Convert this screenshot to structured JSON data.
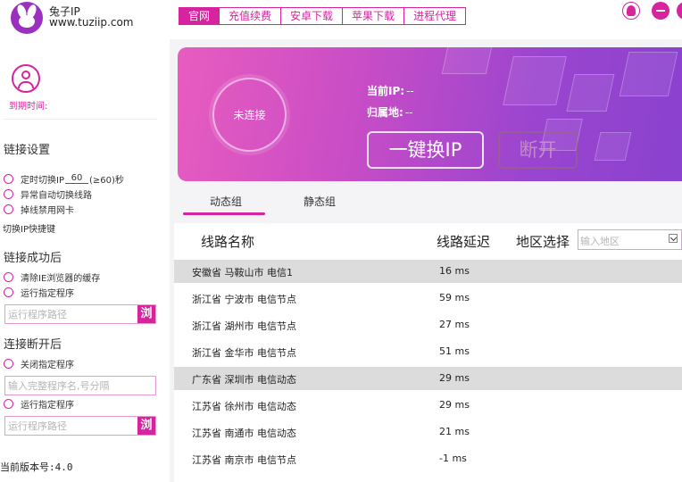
{
  "app": {
    "name": "兔子IP",
    "url": "www.tuziip.com"
  },
  "nav": [
    {
      "label": "官网",
      "active": true
    },
    {
      "label": "充值续费",
      "active": false
    },
    {
      "label": "安卓下载",
      "active": false
    },
    {
      "label": "苹果下载",
      "active": false
    },
    {
      "label": "进程代理",
      "active": false
    }
  ],
  "sidebar": {
    "expiry_label": "到期时间:",
    "link_settings": {
      "title": "链接设置",
      "timer_label": "定时切换IP",
      "timer_value": "60",
      "timer_suffix": "(≥60)秒",
      "auto_switch": "异常自动切换线路",
      "disable_nic": "掉线禁用网卡",
      "hotkey": "切换IP快捷键"
    },
    "on_success": {
      "title": "链接成功后",
      "clear_cache": "清除IE浏览器的缓存",
      "run_program": "运行指定程序",
      "path_placeholder": "运行程序路径",
      "browse": "浏览"
    },
    "on_disconnect": {
      "title": "连接断开后",
      "close_program": "关闭指定程序",
      "close_placeholder": "输入完整程序名,号分隔",
      "run_program": "运行指定程序",
      "path_placeholder": "运行程序路径",
      "browse": "浏览"
    },
    "version": "当前版本号:4.0"
  },
  "status": {
    "connection": "未连接",
    "current_ip_label": "当前IP:",
    "current_ip_value": "--",
    "location_label": "归属地:",
    "location_value": "--",
    "switch_button": "一键换IP",
    "disconnect_button": "断开"
  },
  "tabs": [
    {
      "label": "动态组",
      "active": true
    },
    {
      "label": "静态组",
      "active": false
    }
  ],
  "table": {
    "col_name": "线路名称",
    "col_latency": "线路延迟",
    "region_label": "地区选择",
    "region_placeholder": "输入地区",
    "rows": [
      {
        "name": "安徽省 马鞍山市 电信1",
        "latency": "16 ms",
        "highlight": true
      },
      {
        "name": "浙江省 宁波市 电信节点",
        "latency": "59 ms",
        "highlight": false
      },
      {
        "name": "浙江省 湖州市 电信节点",
        "latency": "27 ms",
        "highlight": false
      },
      {
        "name": "浙江省 金华市 电信节点",
        "latency": "51 ms",
        "highlight": false
      },
      {
        "name": "广东省 深圳市 电信动态",
        "latency": "29 ms",
        "highlight": true
      },
      {
        "name": "江苏省 徐州市 电信动态",
        "latency": "29 ms",
        "highlight": false
      },
      {
        "name": "江苏省 南通市 电信动态",
        "latency": "21 ms",
        "highlight": false
      },
      {
        "name": "江苏省 南京市 电信节点",
        "latency": "-1 ms",
        "highlight": false
      }
    ]
  },
  "colors": {
    "accent": "#d6249f",
    "banner_start": "#e85cbf",
    "banner_end": "#8a42cf",
    "row_highlight": "#dcdcdc"
  }
}
